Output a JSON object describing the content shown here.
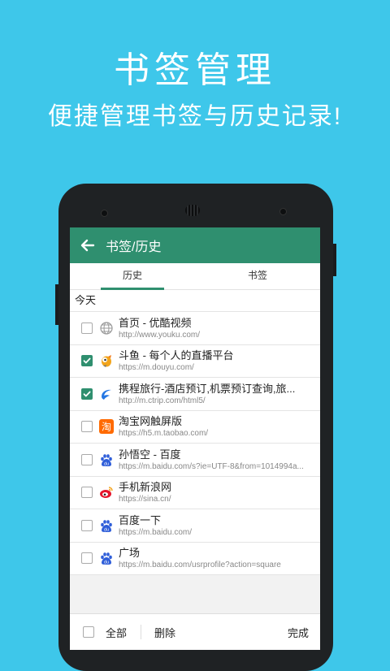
{
  "promo": {
    "title": "书签管理",
    "subtitle": "便捷管理书签与历史记录!"
  },
  "appbar": {
    "back_icon": "arrow-left-icon",
    "title": "书签/历史"
  },
  "tabs": [
    {
      "label": "历史",
      "active": true
    },
    {
      "label": "书签",
      "active": false
    }
  ],
  "section": {
    "label": "今天"
  },
  "items": [
    {
      "title": "首页 - 优酷视频",
      "url": "http://www.youku.com/",
      "checked": false,
      "icon": "globe-icon"
    },
    {
      "title": "斗鱼 - 每个人的直播平台",
      "url": "https://m.douyu.com/",
      "checked": true,
      "icon": "douyu-icon"
    },
    {
      "title": "携程旅行-酒店预订,机票预订查询,旅...",
      "url": "http://m.ctrip.com/html5/",
      "checked": true,
      "icon": "ctrip-icon"
    },
    {
      "title": "淘宝网触屏版",
      "url": "https://h5.m.taobao.com/",
      "checked": false,
      "icon": "taobao-icon"
    },
    {
      "title": "孙悟空 - 百度",
      "url": "https://m.baidu.com/s?ie=UTF-8&from=1014994a...",
      "checked": false,
      "icon": "baidu-icon"
    },
    {
      "title": "手机新浪网",
      "url": "https://sina.cn/",
      "checked": false,
      "icon": "weibo-icon"
    },
    {
      "title": "百度一下",
      "url": "https://m.baidu.com/",
      "checked": false,
      "icon": "baidu-icon"
    },
    {
      "title": "广场",
      "url": "https://m.baidu.com/usrprofile?action=square",
      "checked": false,
      "icon": "baidu-icon"
    }
  ],
  "bottom": {
    "select_all": "全部",
    "delete": "删除",
    "done": "完成"
  },
  "colors": {
    "background": "#3ec7ea",
    "accent": "#2f8f6f"
  }
}
